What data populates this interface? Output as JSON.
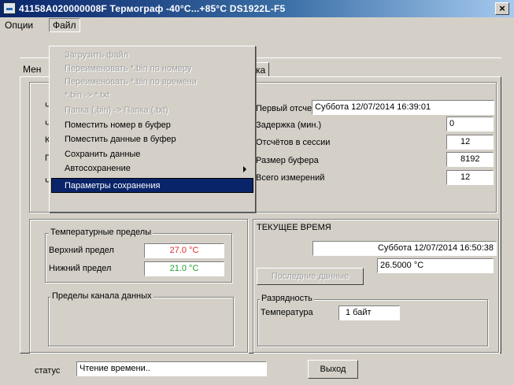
{
  "window": {
    "title": "41158A020000008F  Термограф -40°C...+85°C   DS1922L-F5",
    "close_glyph": "×"
  },
  "menubar": {
    "options": "Опции",
    "file": "Файл"
  },
  "file_menu": {
    "items": [
      {
        "label": "Загрузить файл",
        "enabled": false
      },
      {
        "label": "Переименовать *.bin по номеру",
        "enabled": false
      },
      {
        "label": "Переименовать *.bin по времени",
        "enabled": false
      },
      {
        "label": "*.bin -> *.txt",
        "enabled": false
      },
      {
        "label": "Папка (.bin) -> Папка (.txt)",
        "enabled": false
      },
      {
        "label": "Поместить номер в буфер",
        "enabled": true
      },
      {
        "label": "Поместить данные в буфер",
        "enabled": true
      },
      {
        "label": "Сохранить данные",
        "enabled": true
      },
      {
        "label": "Автосохранение",
        "enabled": true,
        "submenu": true
      },
      {
        "label": "Параметры сохранения",
        "enabled": true,
        "selected": true
      }
    ]
  },
  "tabs": {
    "left_partial": "Мен",
    "right_partial": "ка"
  },
  "left_labels": [
    "Ч",
    "Ч",
    "К",
    "П",
    "Ч"
  ],
  "session": {
    "first_reading_label": "Первый отсчет",
    "first_reading_value": "Суббота 12/07/2014 16:39:01",
    "delay_label": "Задержка (мин.)",
    "delay_value": "0",
    "readings_label": "Отсчётов в сессии",
    "readings_value": "12",
    "buffer_label": "Размер буфера",
    "buffer_value": "8192",
    "total_label": "Всего измерений",
    "total_value": "12"
  },
  "temp_limits": {
    "legend": "Температурные пределы",
    "upper_label": "Верхний предел",
    "upper_value": "27.0 °C",
    "lower_label": "Нижний предел",
    "lower_value": "21.0 °C"
  },
  "channel_limits": {
    "legend": "Пределы канала данных"
  },
  "current_time": {
    "heading": "ТЕКУЩЕЕ ВРЕМЯ",
    "datetime": "Суббота 12/07/2014 16:50:38",
    "last_data_button": "Последние данные",
    "temperature": "26.5000 °C"
  },
  "resolution": {
    "legend": "Разрядность",
    "temp_label": "Температура",
    "temp_value": "1 байт"
  },
  "status": {
    "label": "статус",
    "value": "Чтение времени..",
    "exit_button": "Выход"
  },
  "colors": {
    "upper_limit": "#e0282c",
    "lower_limit": "#1aa22a",
    "selection": "#0a246a"
  }
}
